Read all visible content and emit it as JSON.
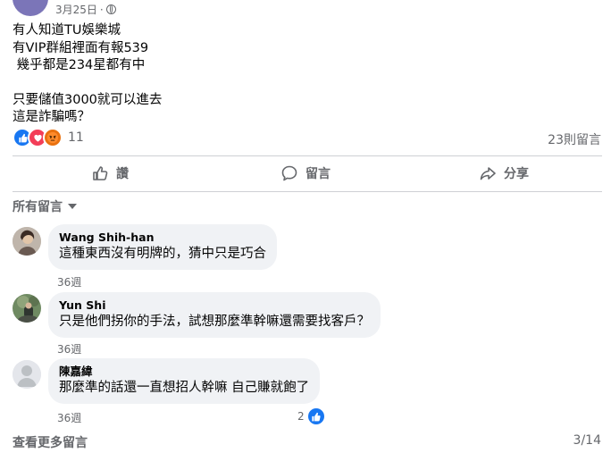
{
  "post": {
    "date": "3月25日",
    "separator": "·",
    "lines": [
      "有人知道TU娛樂城",
      "有VIP群組裡面有報539",
      " 幾乎都是234星都有中",
      "",
      "只要儲值3000就可以進去",
      "這是詐騙嗎？"
    ],
    "reaction_count": "11",
    "comment_count": "23則留言"
  },
  "actions": {
    "like": "讚",
    "comment": "留言",
    "share": "分享"
  },
  "sort": {
    "label": "所有留言"
  },
  "comments": [
    {
      "name": "Wang Shih-han",
      "text": "這種東西沒有明牌的，猜中只是巧合",
      "time": "36週"
    },
    {
      "name": "Yun Shi",
      "text": "只是他們拐你的手法，試想那麼準幹嘛還需要找客戶？",
      "time": "36週"
    },
    {
      "name": "陳嘉緯",
      "text": "那麼準的話還一直想招人幹嘛 自己賺就飽了",
      "time": "36週",
      "likes": "2"
    }
  ],
  "footer": {
    "view_more": "查看更多留言",
    "pagination": "3/14"
  },
  "colors": {
    "accent": "#1877f2",
    "secondary_text": "#65676b",
    "bubble": "#f0f2f5",
    "love": "#f33e58",
    "angry": "#e9710f"
  }
}
